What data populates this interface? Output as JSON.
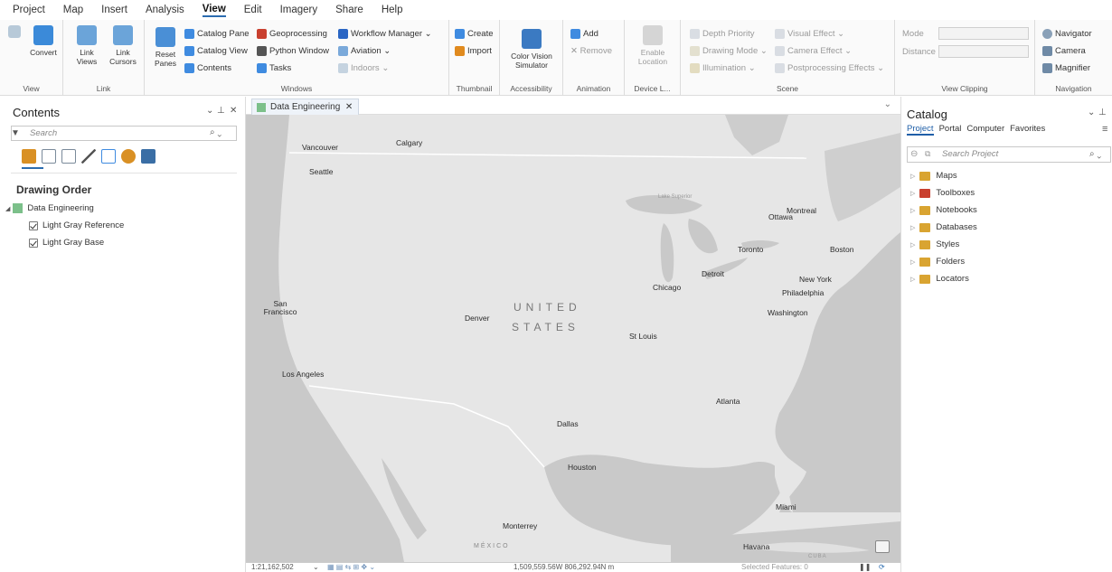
{
  "menu": [
    "Project",
    "Map",
    "Insert",
    "Analysis",
    "View",
    "Edit",
    "Imagery",
    "Share",
    "Help"
  ],
  "ribbon": {
    "view": {
      "convert": "Convert",
      "label": "View"
    },
    "link": {
      "link_views": "Link\nViews",
      "link_cursors": "Link\nCursors",
      "label": "Link"
    },
    "windows": {
      "reset_panes": "Reset\nPanes",
      "catalog_pane": "Catalog Pane",
      "catalog_view": "Catalog View",
      "contents": "Contents",
      "geoprocessing": "Geoprocessing",
      "python_window": "Python Window",
      "tasks": "Tasks",
      "workflow_manager": "Workflow Manager",
      "aviation": "Aviation",
      "indoors": "Indoors",
      "label": "Windows"
    },
    "thumbnail": {
      "create": "Create",
      "import": "Import",
      "label": "Thumbnail"
    },
    "accessibility": {
      "color_vision": "Color Vision\nSimulator",
      "label": "Accessibility"
    },
    "animation": {
      "add": "Add",
      "remove": "Remove",
      "label": "Animation"
    },
    "device": {
      "enable": "Enable\nLocation",
      "label": "Device L..."
    },
    "scene": {
      "depth_priority": "Depth Priority",
      "drawing_mode": "Drawing Mode",
      "illumination": "Illumination",
      "visual_effect": "Visual Effect",
      "camera_effect": "Camera Effect",
      "postprocessing": "Postprocessing Effects",
      "label": "Scene"
    },
    "view_clipping": {
      "mode": "Mode",
      "distance": "Distance",
      "label": "View Clipping"
    },
    "navigation": {
      "navigator": "Navigator",
      "camera": "Camera",
      "magnifier": "Magnifier",
      "label": "Navigation"
    }
  },
  "contents": {
    "title": "Contents",
    "search_placeholder": "Search",
    "drawing_order": "Drawing Order",
    "map_name": "Data Engineering",
    "layers": [
      "Light Gray Reference",
      "Light Gray Base"
    ]
  },
  "map": {
    "tab": "Data Engineering",
    "country": "UNITED",
    "country2": "STATES",
    "mexico": "MÉXICO",
    "cuba": "CUBA",
    "cities": [
      "Vancouver",
      "Calgary",
      "Seattle",
      "Ottawa",
      "Montreal",
      "Toronto",
      "Boston",
      "Detroit",
      "Chicago",
      "New York",
      "Philadelphia",
      "Washington",
      "San Francisco",
      "Denver",
      "St Louis",
      "Los Angeles",
      "Atlanta",
      "Dallas",
      "Houston",
      "Miami",
      "Monterrey",
      "Havana"
    ],
    "lakes": [
      "Lake Superior"
    ],
    "scale": "1:21,162,502",
    "coords": "1,509,559.56W 806,292.94N m",
    "selected": "Selected Features: 0"
  },
  "catalog": {
    "title": "Catalog",
    "tabs": [
      "Project",
      "Portal",
      "Computer",
      "Favorites"
    ],
    "search_placeholder": "Search Project",
    "items": [
      "Maps",
      "Toolboxes",
      "Notebooks",
      "Databases",
      "Styles",
      "Folders",
      "Locators"
    ]
  },
  "colors": {
    "accent": "#2b6cb0",
    "land": "#e6e6e6",
    "water": "#c8c8c8",
    "folder": "#d9a431"
  }
}
